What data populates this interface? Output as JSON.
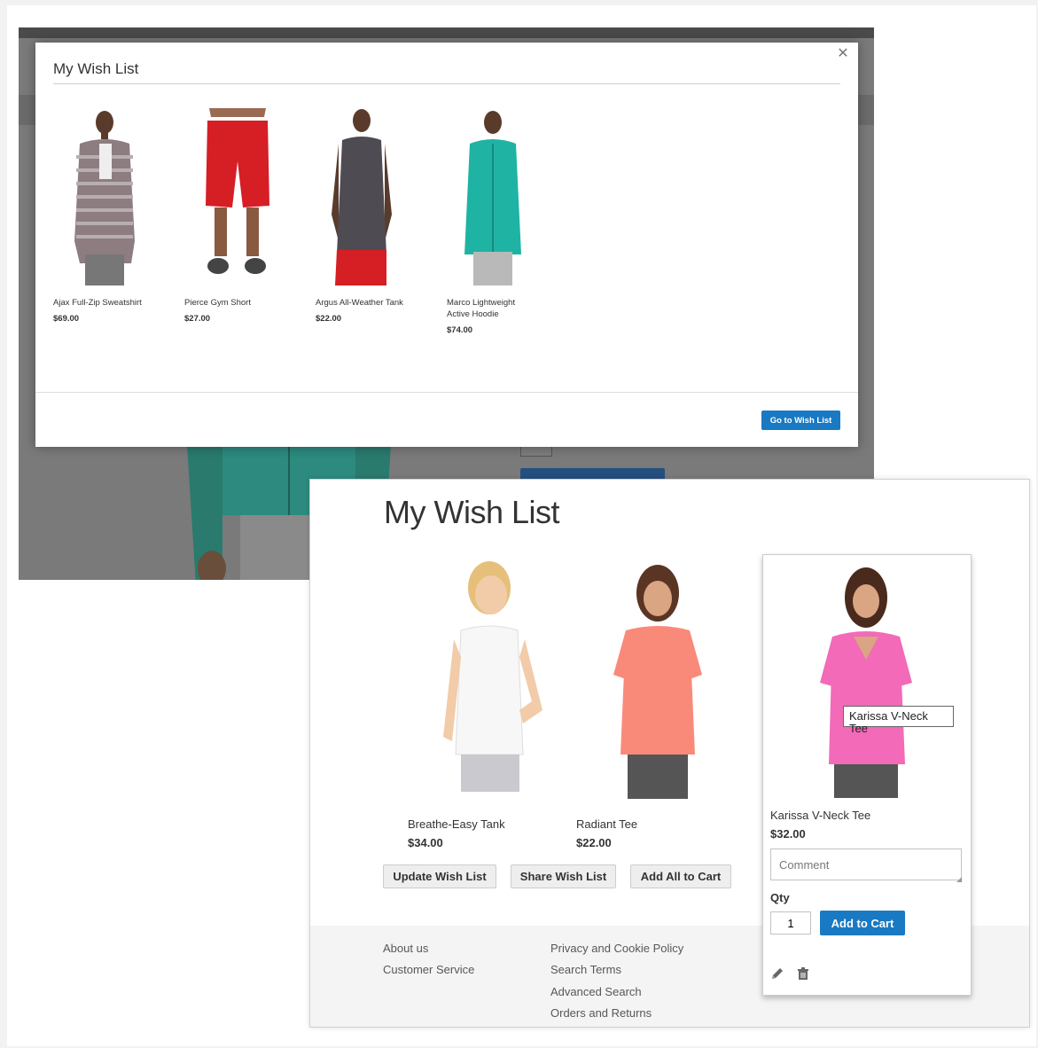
{
  "modal": {
    "title": "My Wish List",
    "close_icon": "close-icon",
    "items": [
      {
        "name": "Ajax Full-Zip Sweatshirt",
        "price": "$69.00"
      },
      {
        "name": "Pierce Gym Short",
        "price": "$27.00"
      },
      {
        "name": "Argus All-Weather Tank",
        "price": "$22.00"
      },
      {
        "name": "Marco Lightweight Active Hoodie",
        "price": "$74.00"
      }
    ],
    "go_button": "Go to Wish List"
  },
  "wishlist": {
    "title": "My Wish List",
    "items": [
      {
        "name": "Breathe-Easy Tank",
        "price": "$34.00"
      },
      {
        "name": "Radiant Tee",
        "price": "$22.00"
      }
    ],
    "card": {
      "name": "Karissa V-Neck Tee",
      "price": "$32.00",
      "comment_placeholder": "Comment",
      "qty_label": "Qty",
      "qty_value": "1",
      "add_to_cart": "Add to Cart",
      "edit_icon": "pencil-icon",
      "delete_icon": "trash-icon",
      "tooltip": "Karissa V-Neck Tee"
    },
    "buttons": {
      "update": "Update Wish List",
      "share": "Share Wish List",
      "add_all": "Add All to Cart"
    }
  },
  "footer": {
    "col1": [
      "About us",
      "Customer Service"
    ],
    "col2": [
      "Privacy and Cookie Policy",
      "Search Terms",
      "Advanced Search",
      "Orders and Returns"
    ]
  },
  "colors": {
    "primary": "#1979c3",
    "overlay": "#7a7a7a",
    "footer_bg": "#f4f4f4"
  }
}
